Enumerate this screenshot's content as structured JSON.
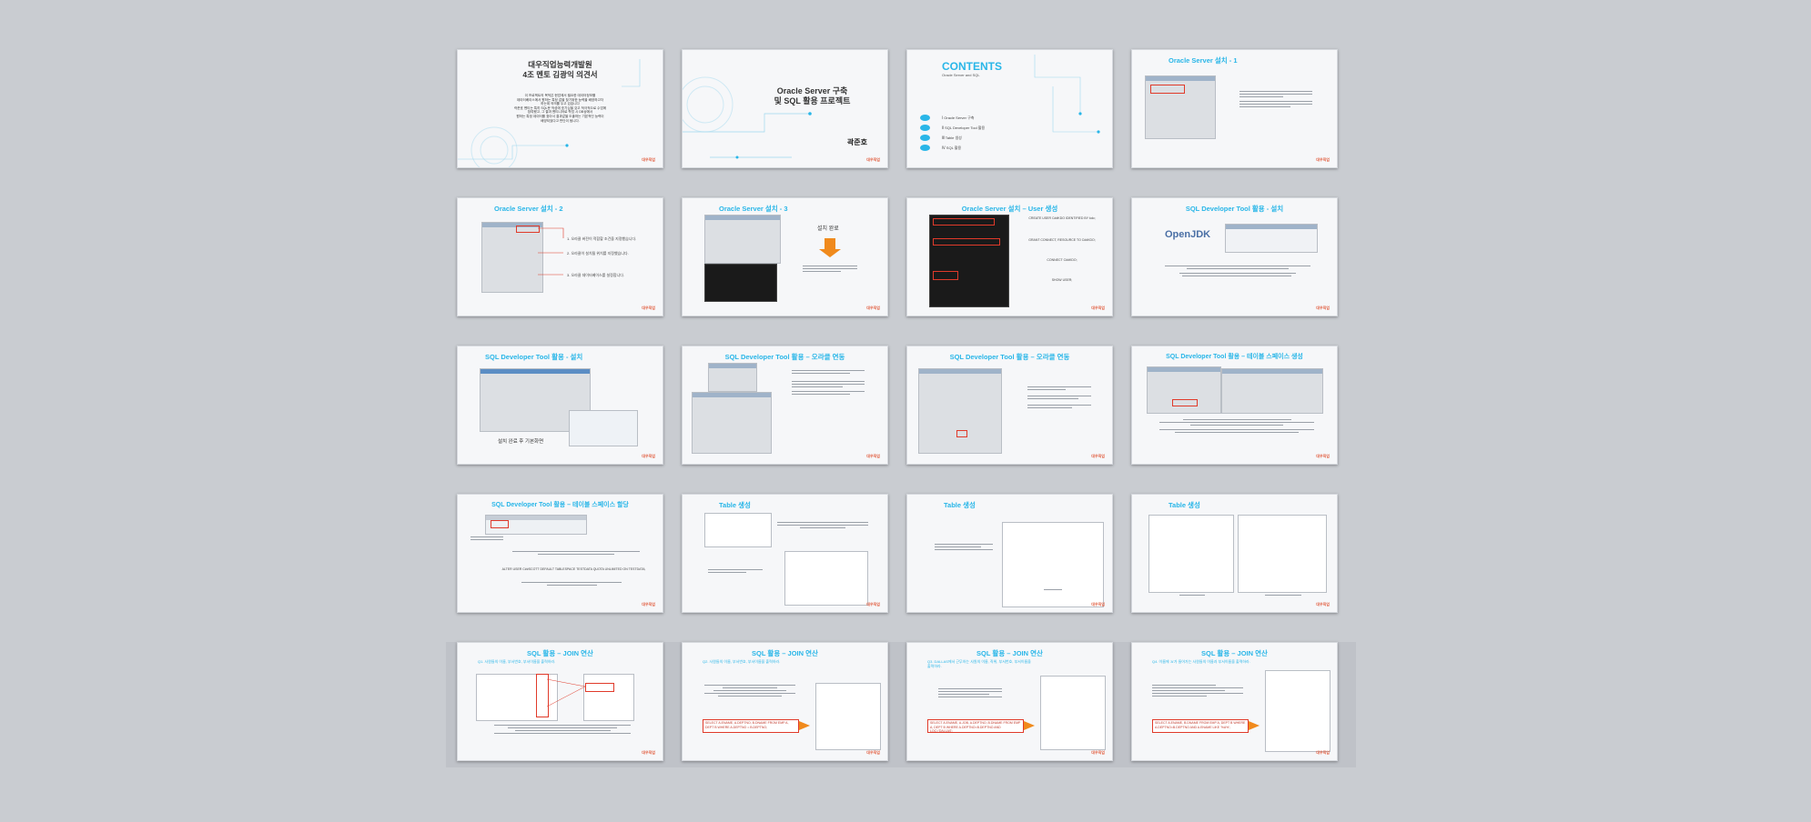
{
  "slides": [
    {
      "id": 1,
      "title": "대우직업능력개발원\n4조 멘토 김광익 의견서",
      "body": "이 프로젝트의 목적은 현업에서 필요한 데이터정보를\n데이터베이스에서 원하는 특정 값을 찾기위한 능력을 배양하고자\n하는데 의의를 두고 있습니다\n곽준호 멘티는 특히 SQL문 작성에 호기심을 갖고 적극적으로 수업에\n참여했고, 그 결과 멘티니어로 학업 시 DB상에서\n원하는 특정 데이터를 찾아서 결과값을 도출하는 기본적인 능력이\n배양되었다고 판단이 됩니다."
    },
    {
      "id": 2,
      "title": "Oracle Server 구축\n및 SQL 활용 프로젝트",
      "author": "곽준호"
    },
    {
      "id": 3,
      "title": "CONTENTS",
      "subtitle": "Oracle Server and SQL",
      "items": [
        "Ⅰ   Oracle Server 구축",
        "Ⅱ   SQL Developer Tool 활용",
        "Ⅲ   Table 생성",
        "Ⅳ   SQL 활용"
      ]
    },
    {
      "id": 4,
      "title": "Oracle Server 설치 - 1"
    },
    {
      "id": 5,
      "title": "Oracle Server 설치 - 2",
      "notes": [
        "1. 오라클 버전이 적합할 조건을 지정했습니다.",
        "2. 오라클이 설치될 위치를 지정했습니다.",
        "3. 오라클 데이터베이스를 설정합니다."
      ]
    },
    {
      "id": 6,
      "title": "Oracle Server 설치 - 3",
      "status": "설치 완료"
    },
    {
      "id": 7,
      "title": "Oracle Server 설치 – User 생성",
      "notes": [
        "CREATE USER C##KDO IDENTIFIED BY kdo;",
        "GRANT CONNECT, RESOURCE TO C##KDO;",
        "CONNECT C##KDO;",
        "SHOW USER;"
      ]
    },
    {
      "id": 8,
      "title": "SQL Developer Tool 활용 - 설치",
      "logo": "OpenJDK"
    },
    {
      "id": 9,
      "title": "SQL Developer Tool 활용 - 설치",
      "caption": "설치 완료 후 기본화면"
    },
    {
      "id": 10,
      "title": "SQL Developer Tool 활용 – 오라클 연동"
    },
    {
      "id": 11,
      "title": "SQL Developer Tool 활용 – 오라클 연동"
    },
    {
      "id": 12,
      "title": "SQL Developer Tool 활용 – 테이블 스페이스 생성"
    },
    {
      "id": 13,
      "title": "SQL Developer Tool 활용 – 테이블 스페이스 할당",
      "notes": [
        "ALTER USER C##SCOTT DEFAULT TABLESPACE TESTDATA QUOTA UNLIMITED ON TESTDATA;"
      ]
    },
    {
      "id": 14,
      "title": "Table 생성"
    },
    {
      "id": 15,
      "title": "Table 생성"
    },
    {
      "id": 16,
      "title": "Table 생성"
    },
    {
      "id": 17,
      "title": "SQL 활용 – JOIN 연산",
      "subtitle": "Q1. 사원들의 이름, 부서번호, 부서이름을 출력하라."
    },
    {
      "id": 18,
      "title": "SQL 활용 – JOIN 연산",
      "subtitle": "Q2. 사원들의 이름, 부서번호, 부서이름을 출력하라.",
      "query": "SELECT A.ENAME, A.DEPTNO, B.DNAME FROM EMP A, DEPT B WHERE A.DEPTNO = B.DEPTNO;"
    },
    {
      "id": 19,
      "title": "SQL 활용 – JOIN 연산",
      "subtitle": "Q3. DALLAS에서 근무하는 사원의 이름, 직위, 부서번호, 부서이름을\n출력하라.",
      "query": "SELECT A.ENAME, A.JOB, A.DEPTNO, B.DNAME FROM EMP A, DEPT B WHERE A.DEPTNO=B.DEPTNO AND LOC='DALLAS';"
    },
    {
      "id": 20,
      "title": "SQL 활용 – JOIN 연산",
      "subtitle": "Q4. 이름에 'A'가 들어가는 사원들의 이름과 부서이름을 출력하라.",
      "query": "SELECT A.ENAME, B.DNAME FROM EMP A, DEPT B WHERE A.DEPTNO=B.DEPTNO AND A.ENAME LIKE '%A%';"
    }
  ],
  "brand_text": "대우직업",
  "colors": {
    "accent": "#29b6e8",
    "brand": "#e15b3c",
    "arrow": "#f08a1c"
  }
}
